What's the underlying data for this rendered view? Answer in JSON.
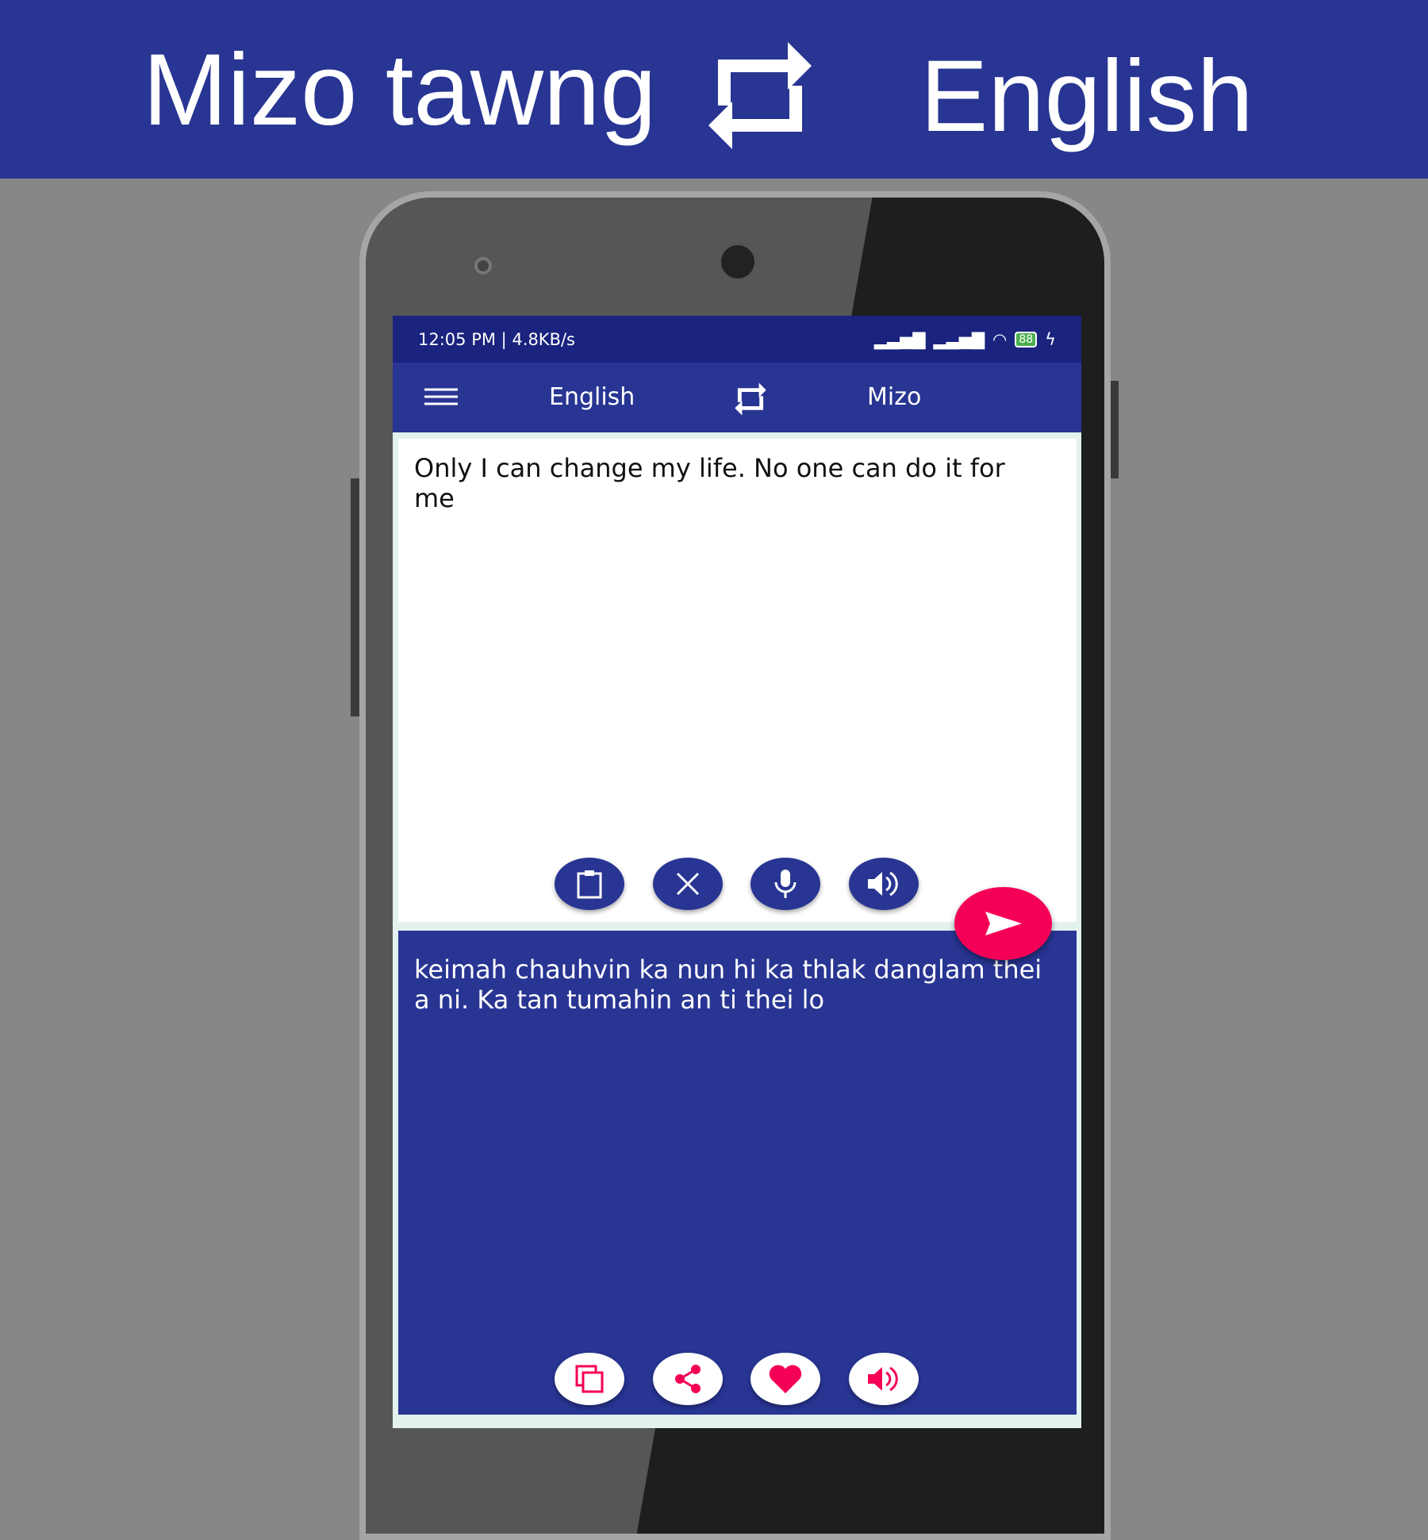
{
  "banner": {
    "source_language": "Mizo tawng",
    "target_language": "English",
    "swap_icon": "swap-arrows-icon"
  },
  "status_bar": {
    "left": "12:05 PM | 4.8KB/s",
    "battery": "88"
  },
  "app_bar": {
    "menu_icon": "hamburger-icon",
    "source_language": "English",
    "target_language": "Mizo",
    "swap_icon": "swap-arrows-icon"
  },
  "input": {
    "text": "Only I can change my life. No one can do it for me",
    "actions": [
      "paste",
      "clear",
      "microphone",
      "speak"
    ]
  },
  "output": {
    "text": "keimah chauhvin ka nun hi ka thlak danglam thei a ni. Ka tan tumahin an ti thei lo",
    "actions": [
      "copy",
      "share",
      "favorite",
      "speak"
    ]
  },
  "colors": {
    "primary": "#283593",
    "accent": "#f50057",
    "status": "#1a237e"
  }
}
